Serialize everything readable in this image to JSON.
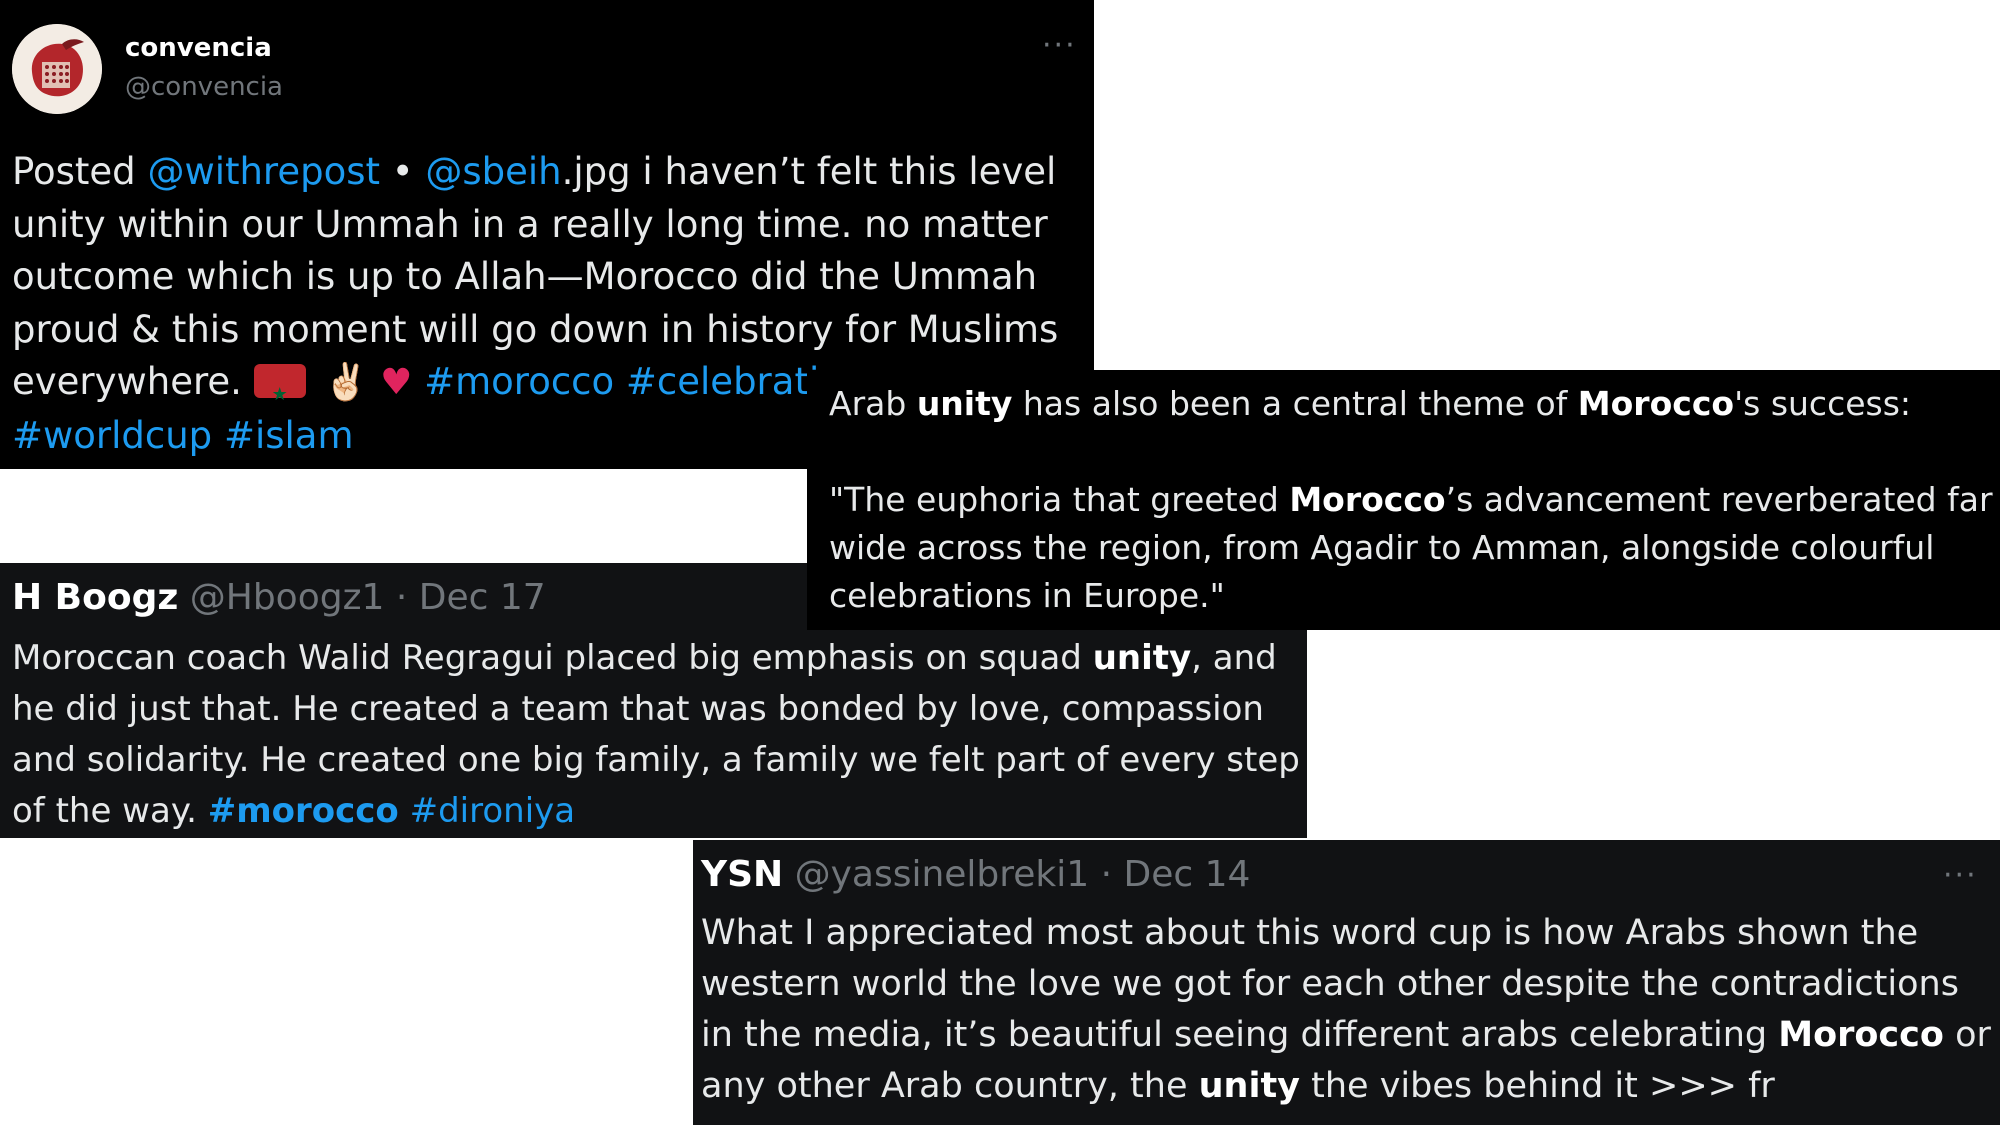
{
  "tweet1": {
    "display_name": "convencia",
    "handle": "@convencia",
    "more_label": "···",
    "text_posted": "Posted ",
    "mention1": "@withrepost",
    "text_bullet": " • ",
    "mention2": "@sbeih",
    "text_main": ".jpg i haven’t felt this level unity within our Ummah in a really long time. no matter outcome which is up to Allah—Morocco did the Ummah proud & this moment will go down in history for Muslims everywhere. ",
    "emoji_flag": "flag-morocco-icon",
    "emoji_victory": "✌🏻",
    "emoji_heart": "♥",
    "hashtag1": "#morocco",
    "hashtag1_rest": " #celebration",
    "hashtag2": "#worldcup",
    "hashtag3": "#islam"
  },
  "quote": {
    "p1_a": "Arab ",
    "p1_b": "unity",
    "p1_c": " has also been a central theme of ",
    "p1_d": "Morocco",
    "p1_e": "'s success:",
    "p2_a": "\"The euphoria that greeted ",
    "p2_b": "Morocco",
    "p2_c": "’s advancement reverberated far and",
    "p2_d": "wide across the region, from Agadir to Amman, alongside colourful",
    "p2_e": "celebrations in Europe.\""
  },
  "tweet2": {
    "display_name": "H Boogz",
    "handle": "@Hboogz1",
    "separator": " · ",
    "date": "Dec 17",
    "t_a": "Moroccan coach Walid Regragui placed big emphasis on squad ",
    "t_b": "unity",
    "t_c": ", and he did just that. He created a team that was bonded by love, compassion and solidarity. He created one big family, a family we felt part of every step of the way. ",
    "hashtag1": "#morocco",
    "hashtag2": "#dironiya"
  },
  "tweet3": {
    "display_name": "YSN",
    "handle": "@yassinelbreki1",
    "separator": " · ",
    "date": "Dec 14",
    "more_label": "···",
    "t_a": "What I appreciated most about this word cup is how Arabs shown the western world the love we got for each other despite the contradictions in the media, it’s beautiful seeing different arabs celebrating ",
    "t_b": "Morocco",
    "t_c": " or any other Arab country, the ",
    "t_d": "unity",
    "t_e": " the vibes behind it >>> fr"
  },
  "colors": {
    "link": "#1d9bf0",
    "card_bg": "#000000",
    "card_bg_dim": "#111214",
    "text": "#e7e9ea",
    "muted": "#71767b"
  }
}
